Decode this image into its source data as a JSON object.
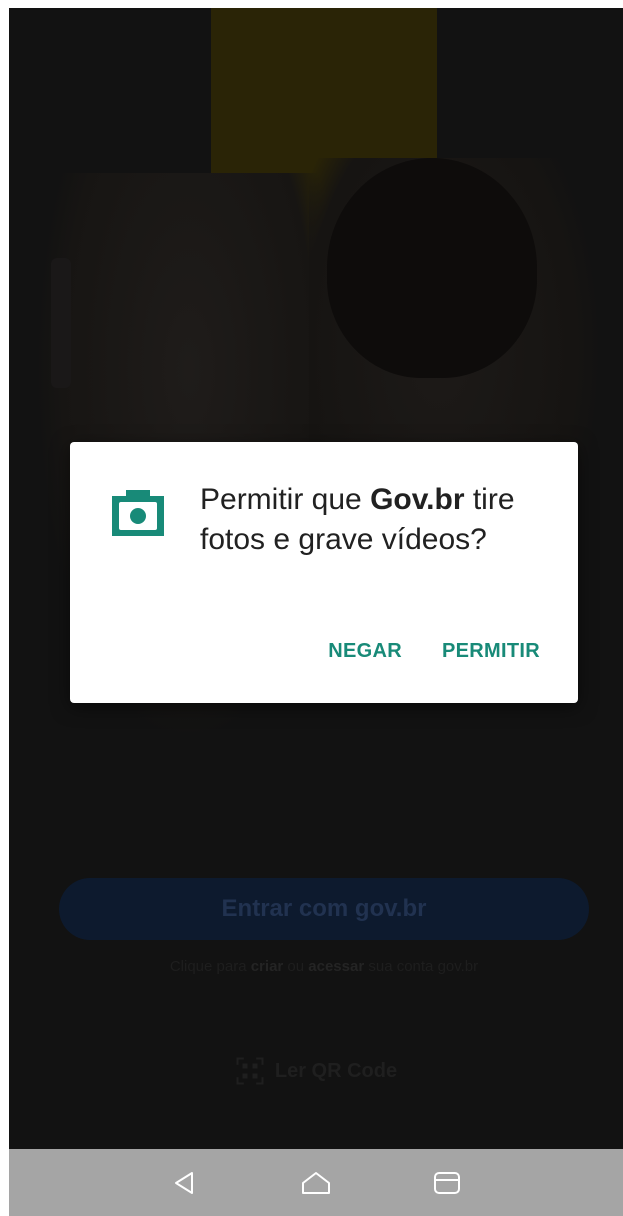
{
  "login": {
    "button_label": "Entrar com gov.br",
    "hint_prefix": "Clique para ",
    "hint_create": "criar",
    "hint_middle": " ou ",
    "hint_access": "acessar",
    "hint_suffix": " sua conta gov.br"
  },
  "qr": {
    "icon": "qr-code-icon",
    "label": "Ler QR Code"
  },
  "dialog": {
    "icon": "camera-icon",
    "message_prefix": "Permitir que ",
    "app_name": "Gov.br",
    "message_suffix": " tire fotos e grave vídeos?",
    "deny_label": "NEGAR",
    "allow_label": "PERMITIR"
  },
  "nav": {
    "back_icon": "back-icon",
    "home_icon": "home-icon",
    "recents_icon": "recents-icon"
  },
  "colors": {
    "accent": "#188a78",
    "scrim": "#121212",
    "nav_bar": "#a5a5a5",
    "login_button": "#0d1a2e"
  }
}
